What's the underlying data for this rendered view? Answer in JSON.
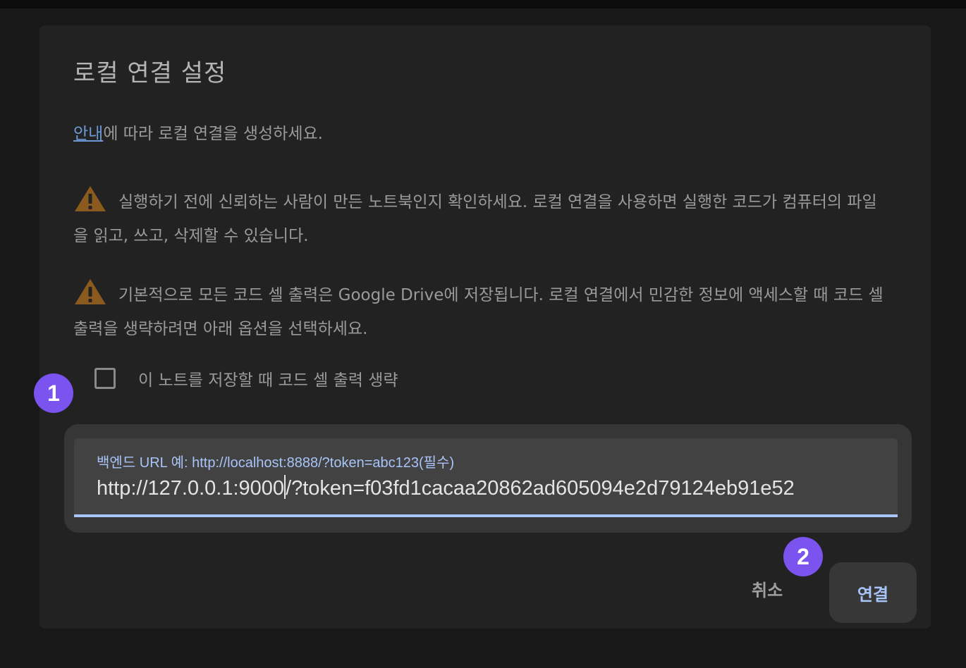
{
  "dialog": {
    "title": "로컬 연결 설정",
    "guide_link": "안내",
    "guide_rest": "에 따라 로컬 연결을 생성하세요.",
    "warning1": "실행하기 전에 신뢰하는 사람이 만든 노트북인지 확인하세요. 로컬 연결을 사용하면 실행한 코드가 컴퓨터의 파일을 읽고, 쓰고, 삭제할 수 있습니다.",
    "warning2": "기본적으로 모든 코드 셀 출력은 Google Drive에 저장됩니다. 로컬 연결에서 민감한 정보에 액세스할 때 코드 셀 출력을 생략하려면 아래 옵션을 선택하세요.",
    "checkbox_label": "이 노트를 저장할 때 코드 셀 출력 생략",
    "checkbox_checked": false,
    "field": {
      "label": "백엔드 URL 예: http://localhost:8888/?token=abc123(필수)",
      "value_before_caret": "http://127.0.0.1:9000",
      "value_after_caret": "/?token=f03fd1cacaa20862ad605094e2d79124eb91e52"
    },
    "cancel_label": "취소",
    "connect_label": "연결"
  },
  "annotations": {
    "step1": "1",
    "step2": "2",
    "badge_color": "#7b53ee"
  },
  "colors": {
    "accent": "#a8c4f8",
    "link": "#6b9ad6",
    "warning": "#8a5a1e"
  },
  "icons": {
    "warning": "warning-triangle-icon"
  }
}
